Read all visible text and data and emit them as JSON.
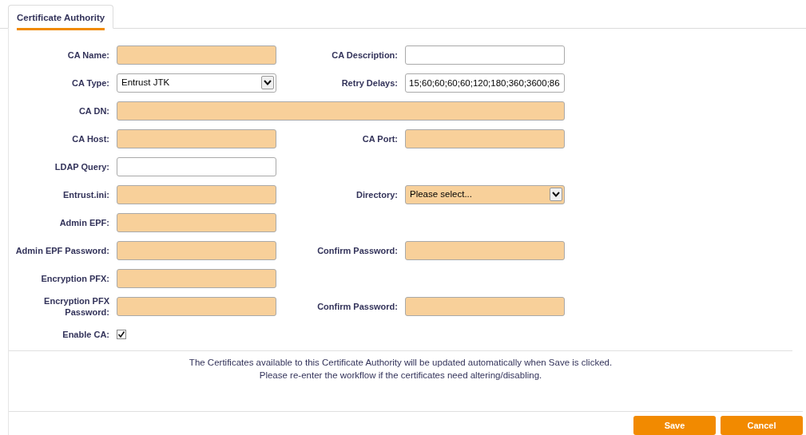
{
  "tabs": [
    {
      "label": "Certificate Authority",
      "selected": true
    }
  ],
  "rows": [
    {
      "fields": [
        {
          "label": "CA Name:",
          "kind": "text",
          "required": true
        },
        {
          "label": "CA Description:",
          "kind": "text",
          "required": false
        }
      ]
    },
    {
      "fields": [
        {
          "label": "CA Type:",
          "kind": "select",
          "required": false,
          "value": "Entrust JTK"
        },
        {
          "label": "Retry Delays:",
          "kind": "text",
          "required": false,
          "value": "15;60;60;60;60;120;180;360;3600;86"
        }
      ]
    },
    {
      "fields": [
        {
          "label": "CA DN:",
          "kind": "wide",
          "required": true
        }
      ]
    },
    {
      "fields": [
        {
          "label": "CA Host:",
          "kind": "text",
          "required": true
        },
        {
          "label": "CA Port:",
          "kind": "text",
          "required": true
        }
      ]
    },
    {
      "fields": [
        {
          "label": "LDAP Query:",
          "kind": "text",
          "required": false
        }
      ]
    },
    {
      "fields": [
        {
          "label": "Entrust.ini:",
          "kind": "text",
          "required": true
        },
        {
          "label": "Directory:",
          "kind": "select",
          "required": true,
          "value": "Please select..."
        }
      ]
    },
    {
      "fields": [
        {
          "label": "Admin EPF:",
          "kind": "text",
          "required": true
        }
      ]
    },
    {
      "fields": [
        {
          "label": "Admin EPF Password:",
          "kind": "text",
          "required": true
        },
        {
          "label": "Confirm Password:",
          "kind": "text",
          "required": true
        }
      ]
    },
    {
      "fields": [
        {
          "label": "Encryption PFX:",
          "kind": "text",
          "required": true
        }
      ]
    },
    {
      "fields": [
        {
          "label": "Encryption PFX Password:",
          "kind": "text",
          "required": true
        },
        {
          "label": "Confirm Password:",
          "kind": "text",
          "required": true
        }
      ]
    },
    {
      "fields": [
        {
          "label": "Enable CA:",
          "kind": "checkbox",
          "checked": true
        }
      ]
    }
  ],
  "notice": [
    "The Certificates available to this Certificate Authority will be updated automatically when Save is clicked.",
    "Please re-enter the workflow if the certificates need altering/disabling."
  ],
  "buttons": [
    "Save",
    "Cancel"
  ]
}
